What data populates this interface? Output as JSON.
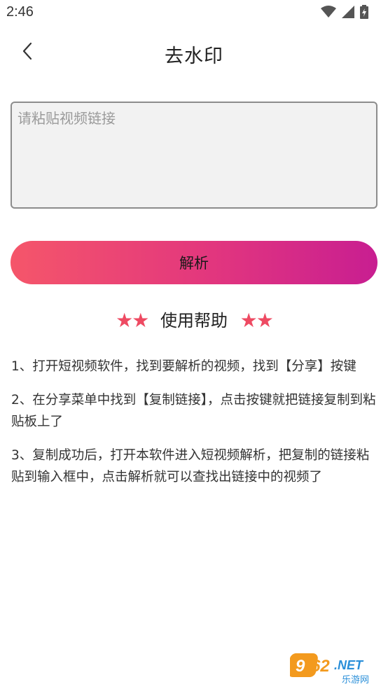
{
  "status_bar": {
    "time": "2:46",
    "icons": [
      "wifi-icon",
      "cellular-signal-icon",
      "battery-charging-icon"
    ]
  },
  "header": {
    "back_icon": "chevron-left-icon",
    "title": "去水印"
  },
  "input": {
    "placeholder": "请粘贴视频链接",
    "value": ""
  },
  "parse_button": {
    "label": "解析"
  },
  "help": {
    "stars_left": "★★",
    "title": "使用帮助",
    "stars_right": "★★",
    "steps": [
      "1、打开短视频软件，找到要解析的视频，找到【分享】按键",
      "2、在分享菜单中找到【复制链接】，点击按键就把链接复制到粘贴板上了",
      "3、复制成功后，打开本软件进入短视频解析，把复制的链接粘贴到输入框中，点击解析就可以查找出链接中的视频了"
    ]
  },
  "watermark": {
    "brand": "962.NET",
    "sub": "乐游网"
  },
  "colors": {
    "button_gradient_start": "#f5566a",
    "button_gradient_end": "#c81e91",
    "star": "#ee4a62",
    "watermark_orange": "#f39a1e",
    "watermark_blue": "#2a8fd9"
  }
}
